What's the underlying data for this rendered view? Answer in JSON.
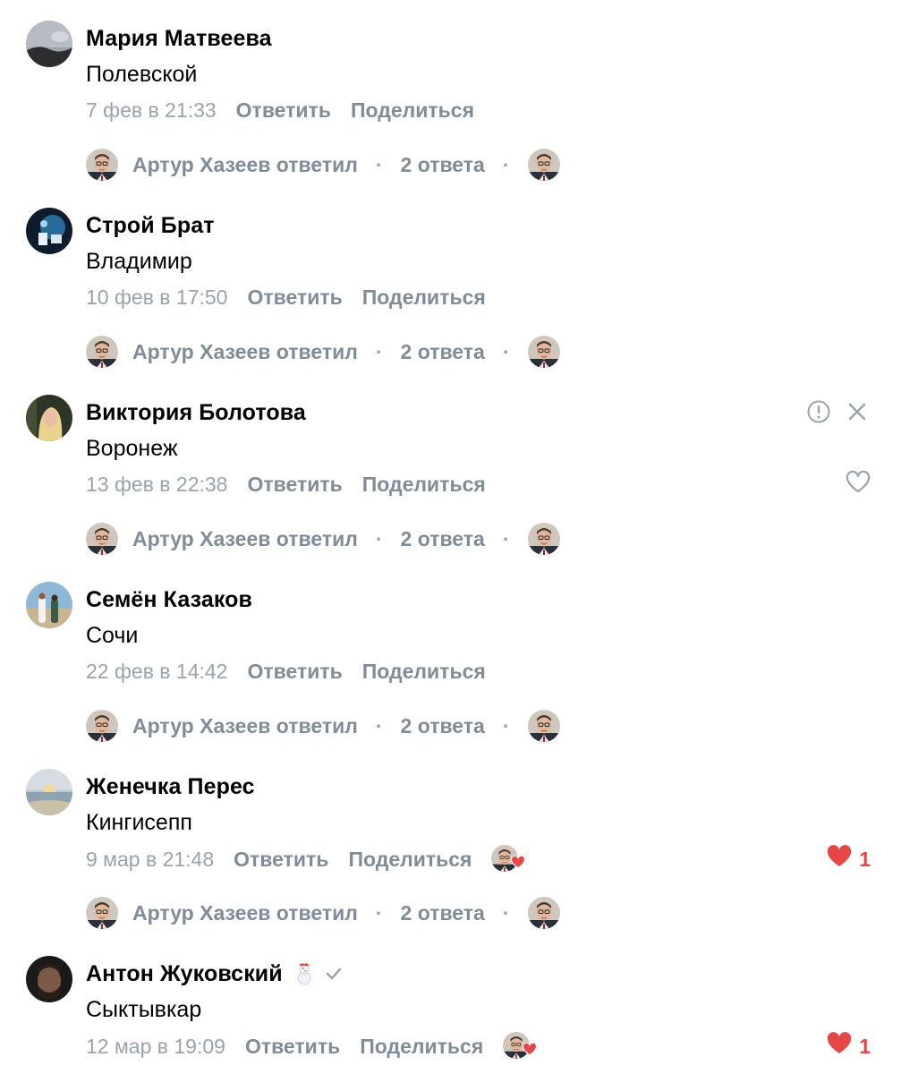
{
  "comments": [
    {
      "name": "Мария Матвеева",
      "text": "Полевской",
      "date": "7 фев в 21:33",
      "reply": "Ответить",
      "share": "Поделиться",
      "thread_author": "Артур Хазеев ответил",
      "thread_count": "2 ответа"
    },
    {
      "name": "Строй Брат",
      "text": "Владимир",
      "date": "10 фев в 17:50",
      "reply": "Ответить",
      "share": "Поделиться",
      "thread_author": "Артур Хазеев ответил",
      "thread_count": "2 ответа"
    },
    {
      "name": "Виктория Болотова",
      "text": "Воронеж",
      "date": "13 фев в 22:38",
      "reply": "Ответить",
      "share": "Поделиться",
      "thread_author": "Артур Хазеев ответил",
      "thread_count": "2 ответа"
    },
    {
      "name": "Семён Казаков",
      "text": "Сочи",
      "date": "22 фев в 14:42",
      "reply": "Ответить",
      "share": "Поделиться",
      "thread_author": "Артур Хазеев ответил",
      "thread_count": "2 ответа"
    },
    {
      "name": "Женечка Перес",
      "text": "Кингисепп",
      "date": "9 мар в 21:48",
      "reply": "Ответить",
      "share": "Поделиться",
      "likes": "1",
      "thread_author": "Артур Хазеев ответил",
      "thread_count": "2 ответа"
    },
    {
      "name": "Антон Жуковский",
      "text": "Сыктывкар",
      "date": "12 мар в 19:09",
      "reply": "Ответить",
      "share": "Поделиться",
      "likes": "1"
    }
  ],
  "colors": {
    "secondary_text": "#818c99",
    "date_text": "#99a2ad",
    "like_red": "#e64646"
  },
  "icons": [
    "report-icon",
    "close-icon",
    "heart-outline-icon",
    "heart-filled-icon",
    "verified-check-icon",
    "snowman-emoji-badge"
  ]
}
